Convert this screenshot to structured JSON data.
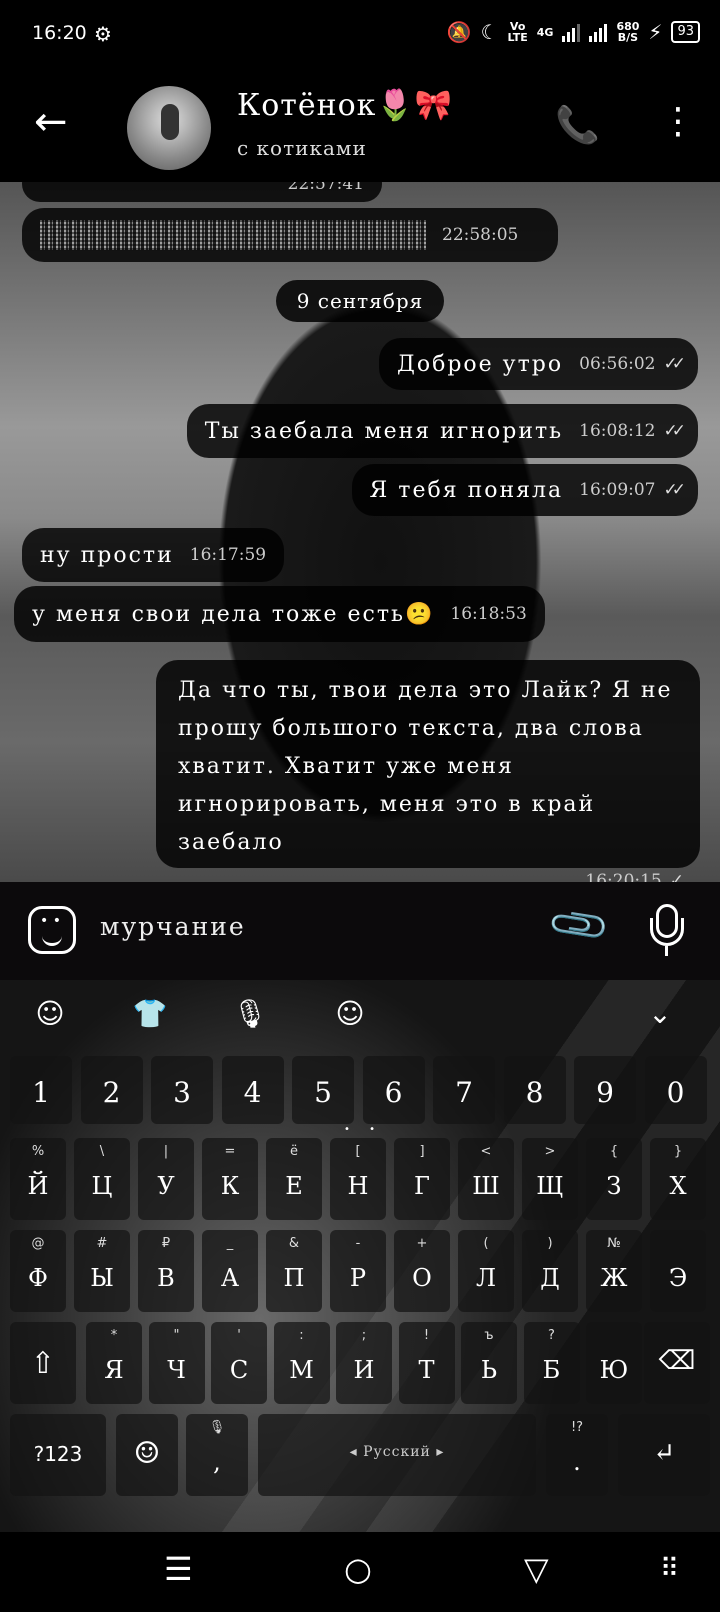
{
  "status_bar": {
    "time": "16:20",
    "network_volte": "Vo\nLTE",
    "network_type": "4G",
    "speed_value": "680",
    "speed_unit": "B/S",
    "battery": "93"
  },
  "header": {
    "title": "Котёнок🌷🎀",
    "subtitle": "с котиками"
  },
  "messages": [
    {
      "side": "in",
      "text": "",
      "time": "22:58:05",
      "hidden": true
    },
    {
      "side": "out",
      "text": "Доброе утро",
      "time": "06:56:02",
      "ticks": "✓✓"
    },
    {
      "side": "out",
      "text": "Ты заебала меня игнорить",
      "time": "16:08:12",
      "ticks": "✓✓"
    },
    {
      "side": "out",
      "text": "Я тебя поняла",
      "time": "16:09:07",
      "ticks": "✓✓"
    },
    {
      "side": "in",
      "text": "ну прости",
      "time": "16:17:59"
    },
    {
      "side": "in",
      "text": "у меня свои дела тоже есть😕",
      "time": "16:18:53"
    },
    {
      "side": "out",
      "text": "Да что ты, твои дела это Лайк? Я не прошу большого текста, два слова хватит. Хватит уже меня игнорировать, меня это в край заебало",
      "time": "16:20:15",
      "ticks": "✓"
    }
  ],
  "top_partial_time": "22:57:41",
  "date_separator": "9 сентября",
  "input": {
    "placeholder": "мурчание"
  },
  "keyboard": {
    "number_row": [
      "1",
      "2",
      "3",
      "4",
      "5",
      "6",
      "7",
      "8",
      "9",
      "0"
    ],
    "row1": [
      {
        "hint": "%",
        "key": "Й"
      },
      {
        "hint": "\\",
        "key": "Ц"
      },
      {
        "hint": "|",
        "key": "У"
      },
      {
        "hint": "=",
        "key": "К"
      },
      {
        "hint": "ё",
        "key": "Е"
      },
      {
        "hint": "[",
        "key": "Н"
      },
      {
        "hint": "]",
        "key": "Г"
      },
      {
        "hint": "<",
        "key": "Ш"
      },
      {
        "hint": ">",
        "key": "Щ"
      },
      {
        "hint": "{",
        "key": "З"
      },
      {
        "hint": "}",
        "key": "Х"
      }
    ],
    "row2": [
      {
        "hint": "@",
        "key": "Ф"
      },
      {
        "hint": "#",
        "key": "Ы"
      },
      {
        "hint": "₽",
        "key": "В"
      },
      {
        "hint": "_",
        "key": "А"
      },
      {
        "hint": "&",
        "key": "П"
      },
      {
        "hint": "-",
        "key": "Р"
      },
      {
        "hint": "+",
        "key": "О"
      },
      {
        "hint": "(",
        "key": "Л"
      },
      {
        "hint": ")",
        "key": "Д"
      },
      {
        "hint": "№",
        "key": "Ж"
      },
      {
        "hint": "",
        "key": "Э"
      }
    ],
    "row3": [
      {
        "hint": "*",
        "key": "Я"
      },
      {
        "hint": "\"",
        "key": "Ч"
      },
      {
        "hint": "'",
        "key": "С"
      },
      {
        "hint": ":",
        "key": "М"
      },
      {
        "hint": ";",
        "key": "И"
      },
      {
        "hint": "!",
        "key": "Т"
      },
      {
        "hint": "ъ",
        "key": "Ь"
      },
      {
        "hint": "?",
        "key": "Б"
      },
      {
        "hint": "",
        "key": "Ю"
      }
    ],
    "symbols_key": "?123",
    "comma_key": ",",
    "space_label": "◂ Русский ▸",
    "period_hint": "!?",
    "period_key": "."
  }
}
